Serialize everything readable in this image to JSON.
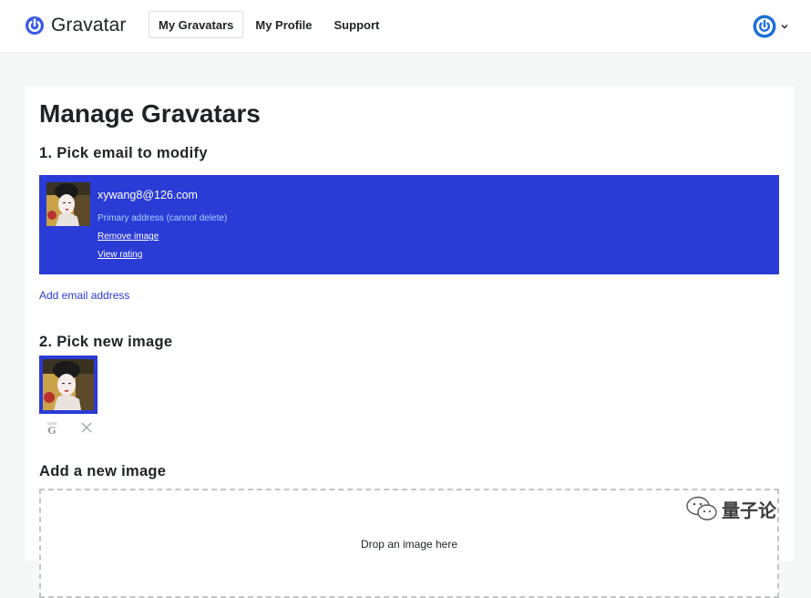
{
  "brand": {
    "name": "Gravatar",
    "logo_icon": "gravatar-power-icon",
    "accent": "#3858e9"
  },
  "nav": {
    "items": [
      {
        "label": "My Gravatars",
        "active": true
      },
      {
        "label": "My Profile",
        "active": false
      },
      {
        "label": "Support",
        "active": false
      }
    ]
  },
  "account": {
    "avatar_icon": "gravatar-avatar-icon",
    "chevron_icon": "chevron-down-icon"
  },
  "page": {
    "title": "Manage Gravatars"
  },
  "section1": {
    "title": "1. Pick email to modify",
    "selected_color": "#2a3bd6",
    "email": {
      "address": "xywang8@126.com",
      "primary_note": "Primary address (cannot delete)",
      "remove_image": "Remove image",
      "view_rating": "View rating"
    },
    "add_email": "Add email address"
  },
  "section2": {
    "title": "2. Pick new image",
    "image_actions": {
      "rating_icon": "rating-g-icon",
      "delete_icon": "close-icon"
    }
  },
  "section3": {
    "title": "Add a new image",
    "dropzone_text": "Drop an image here"
  },
  "watermark": {
    "icon": "wechat-icon",
    "text": "量子论"
  }
}
